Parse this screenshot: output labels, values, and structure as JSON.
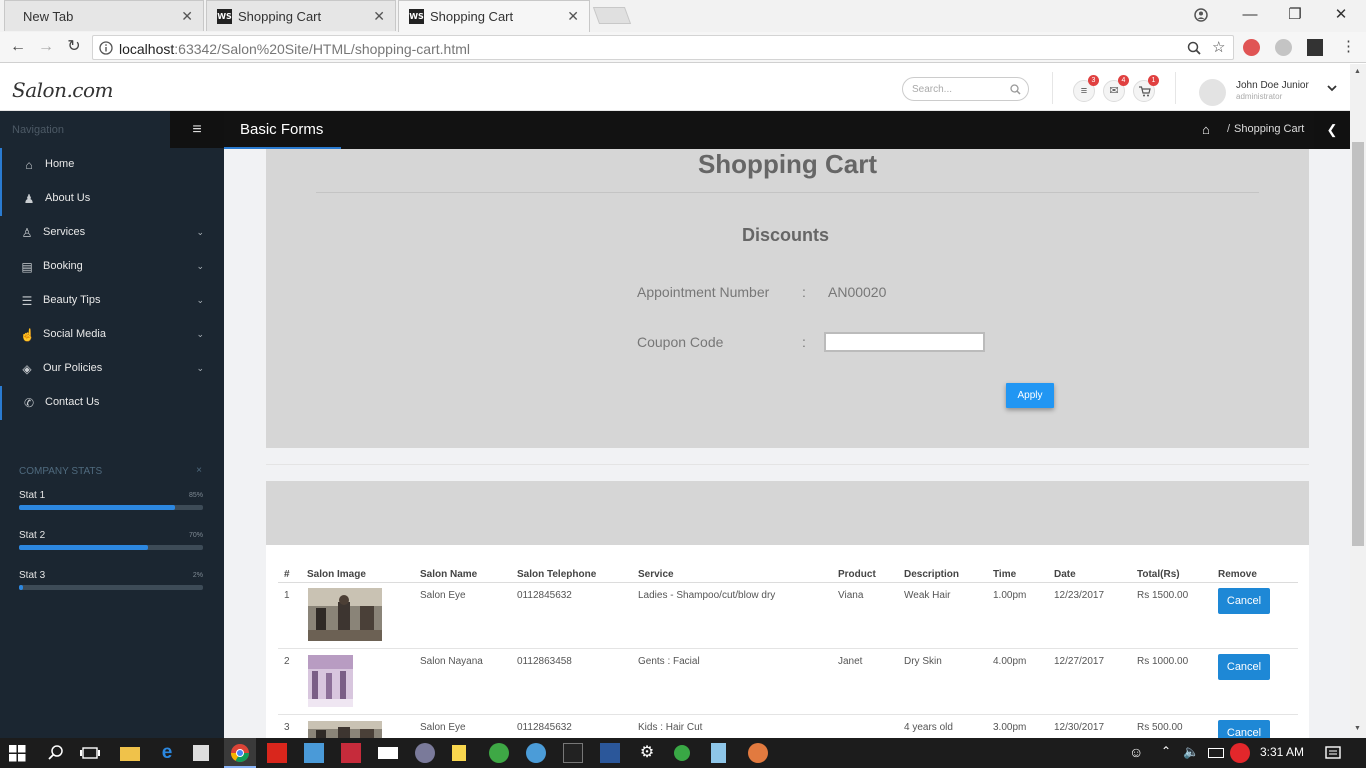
{
  "browser": {
    "tabs": [
      {
        "title": "New Tab",
        "active": false
      },
      {
        "title": "Shopping Cart",
        "active": false
      },
      {
        "title": "Shopping Cart",
        "active": true
      }
    ],
    "url": {
      "host": "localhost",
      "rest": ":63342/Salon%20Site/HTML/shopping-cart.html"
    }
  },
  "header": {
    "logo": "Salon.com",
    "search_placeholder": "Search...",
    "badges": {
      "menu": "3",
      "mail": "4",
      "cart": "1"
    },
    "user": {
      "name": "John Doe Junior",
      "role": "administrator"
    }
  },
  "sidebar": {
    "title": "Navigation",
    "items": [
      {
        "label": "Home",
        "icon": "home-icon",
        "has_children": false
      },
      {
        "label": "About Us",
        "icon": "users-icon",
        "has_children": false
      },
      {
        "label": "Services",
        "icon": "person-icon",
        "has_children": true
      },
      {
        "label": "Booking",
        "icon": "book-icon",
        "has_children": true
      },
      {
        "label": "Beauty Tips",
        "icon": "list-icon",
        "has_children": true
      },
      {
        "label": "Social Media",
        "icon": "hand-icon",
        "has_children": true
      },
      {
        "label": "Our Policies",
        "icon": "cube-icon",
        "has_children": true
      },
      {
        "label": "Contact Us",
        "icon": "phone-icon",
        "has_children": false
      }
    ],
    "stats": {
      "title": "COMPANY STATS",
      "close": "×",
      "items": [
        {
          "label": "Stat 1",
          "percent_text": "85%",
          "value": 0.85
        },
        {
          "label": "Stat 2",
          "percent_text": "70%",
          "value": 0.7
        },
        {
          "label": "Stat 3",
          "percent_text": "2%",
          "value": 0.02
        }
      ]
    }
  },
  "pagebar": {
    "title": "Basic Forms",
    "breadcrumb_sep": "/",
    "breadcrumb_current": "Shopping Cart"
  },
  "main": {
    "heading": "Shopping Cart",
    "discounts": {
      "heading": "Discounts",
      "appointment_label": "Appointment Number",
      "appointment_value": "AN00020",
      "coupon_label": "Coupon Code",
      "colon": ":",
      "coupon_value": "",
      "apply_label": "Apply"
    },
    "table": {
      "columns": [
        "#",
        "Salon Image",
        "Salon Name",
        "Salon Telephone",
        "Service",
        "Product",
        "Description",
        "Time",
        "Date",
        "Total(Rs)",
        "Remove"
      ],
      "rows": [
        {
          "num": "1",
          "name": "Salon Eye",
          "telephone": "0112845632",
          "service": "Ladies - Shampoo/cut/blow dry",
          "product": "Viana",
          "description": "Weak Hair",
          "time": "1.00pm",
          "date": "12/23/2017",
          "total": "Rs 1500.00",
          "remove": "Cancel"
        },
        {
          "num": "2",
          "name": "Salon Nayana",
          "telephone": "0112863458",
          "service": "Gents : Facial",
          "product": "Janet",
          "description": "Dry Skin",
          "time": "4.00pm",
          "date": "12/27/2017",
          "total": "Rs 1000.00",
          "remove": "Cancel"
        },
        {
          "num": "3",
          "name": "Salon Eye",
          "telephone": "0112845632",
          "service": "Kids : Hair Cut",
          "product": "",
          "description": "4 years old",
          "time": "3.00pm",
          "date": "12/30/2017",
          "total": "Rs 500.00",
          "remove": "Cancel"
        }
      ]
    }
  },
  "taskbar": {
    "time": "3:31 AM"
  },
  "colors": {
    "accent": "#2a7bd1",
    "sidebar_bg": "#1b2631",
    "apply_button": "#2196f3",
    "cancel_button": "#1e88d6"
  }
}
